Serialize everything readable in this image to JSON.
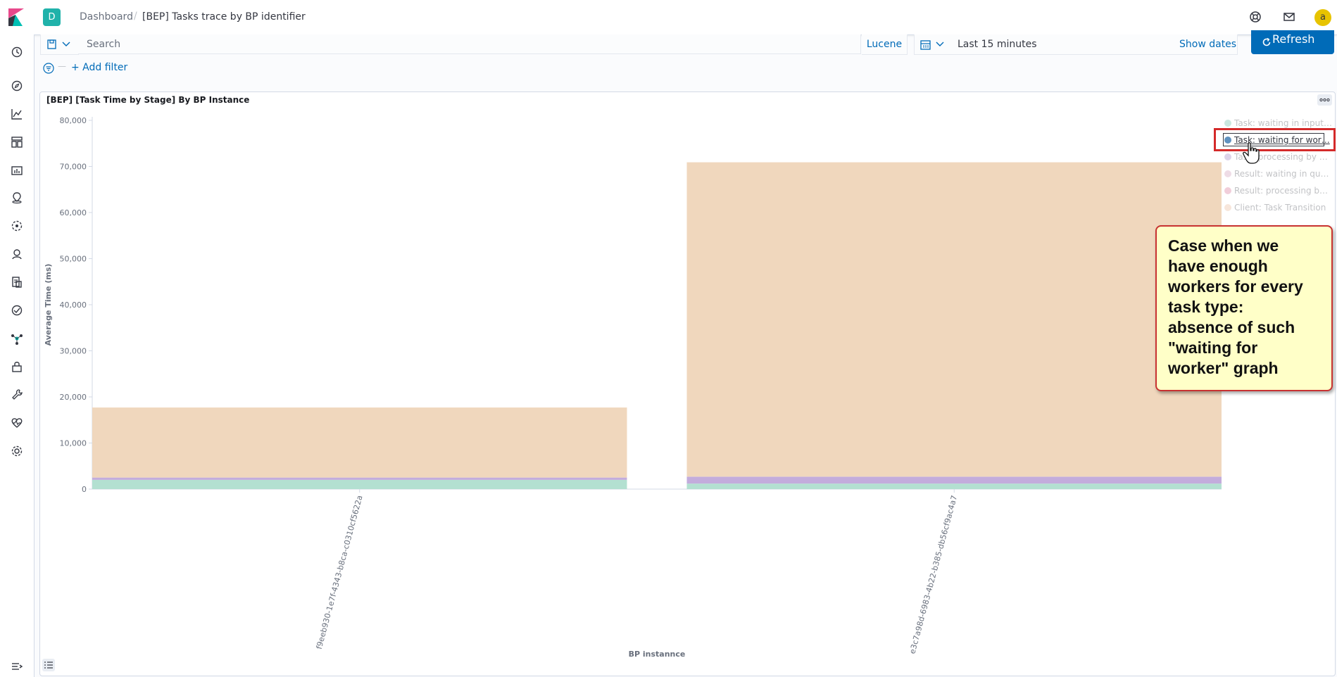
{
  "header": {
    "app_badge": "D",
    "breadcrumb": [
      "Dashboard",
      "[BEP] Tasks trace by BP identifier"
    ],
    "avatar_letter": "a"
  },
  "query": {
    "search_placeholder": "Search",
    "language": "Lucene",
    "time_range": "Last 15 minutes",
    "show_dates": "Show dates",
    "refresh_label": "Refresh"
  },
  "filters": {
    "add_filter": "+ Add filter"
  },
  "panel": {
    "title": "[BEP] [Task Time by Stage] By BP Instance"
  },
  "legend": [
    {
      "label": "Task: waiting in input…",
      "color": "#54b399",
      "faded": true
    },
    {
      "label": "Task: waiting for wor…",
      "color": "#6092c0",
      "faded": false
    },
    {
      "label": "Task: processing by …",
      "color": "#9170b8",
      "faded": true
    },
    {
      "label": "Result: waiting in qu…",
      "color": "#ca8eae",
      "faded": true
    },
    {
      "label": "Result: processing b…",
      "color": "#d36086",
      "faded": true
    },
    {
      "label": "Client: Task Transition",
      "color": "#e7b08a",
      "faded": true
    }
  ],
  "annotation": {
    "lines": [
      "Case when we",
      "have enough",
      "workers for every",
      "task type:",
      "absence of such",
      "\"waiting for",
      "worker\" graph"
    ]
  },
  "chart_data": {
    "type": "bar",
    "stacked": true,
    "title": "[BEP] [Task Time by Stage] By BP Instance",
    "xlabel": "BP instannce",
    "ylabel": "Average Time (ms)",
    "ylim": [
      0,
      80000
    ],
    "yticks": [
      0,
      10000,
      20000,
      30000,
      40000,
      50000,
      60000,
      70000,
      80000
    ],
    "ytick_labels": [
      "0",
      "10,000",
      "20,000",
      "30,000",
      "40,000",
      "50,000",
      "60,000",
      "70,000",
      "80,000"
    ],
    "categories": [
      "f9eeb930-1e7f-4343-b8ca-c0310cf5622a",
      "e3c7a98d-6983-4b22-b385-db56cf9ac4a7"
    ],
    "series": [
      {
        "name": "Task: waiting in input…",
        "color": "#b3e0d1",
        "values": [
          2000,
          1200
        ]
      },
      {
        "name": "Task: processing by …",
        "color": "#c3acdc",
        "values": [
          500,
          1500
        ]
      },
      {
        "name": "Client: Task Transition",
        "color": "#f0d7bd",
        "values": [
          15200,
          68200
        ]
      }
    ],
    "legend_position": "top-right",
    "grid": false
  }
}
